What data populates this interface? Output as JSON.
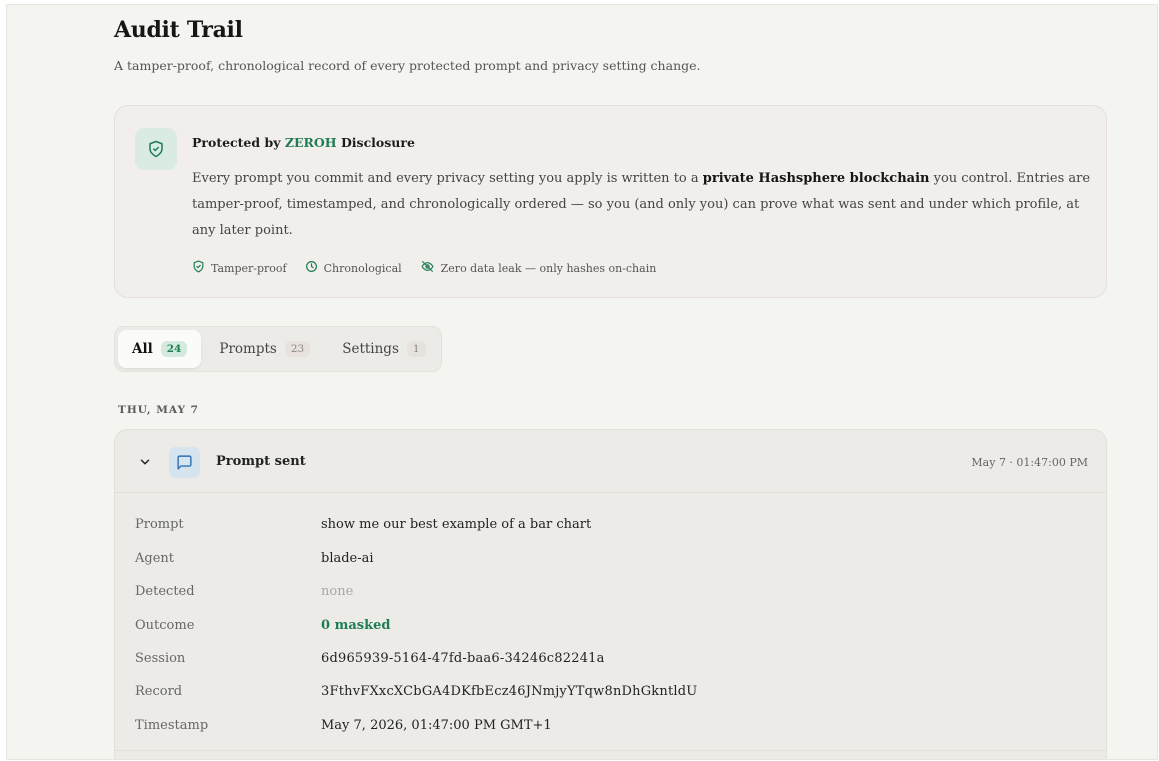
{
  "header": {
    "title": "Audit Trail",
    "subtitle": "A tamper-proof, chronological record of every protected prompt and privacy setting change."
  },
  "banner": {
    "icon": "shield-check-icon",
    "heading_prefix": "Protected by ",
    "heading_brand": "ZEROH",
    "heading_suffix": " Disclosure",
    "body_part1": "Every prompt you commit and every privacy setting you apply is written to a ",
    "body_bold": "private Hashsphere blockchain",
    "body_part2": " you control. Entries are tamper-proof, timestamped, and chronologically ordered — so you (and only you) can prove what was sent and under which profile, at any later point.",
    "features": [
      {
        "icon": "shield-check-icon",
        "label": "Tamper-proof"
      },
      {
        "icon": "clock-icon",
        "label": "Chronological"
      },
      {
        "icon": "eye-off-icon",
        "label": "Zero data leak — only hashes on-chain"
      }
    ]
  },
  "tabs": [
    {
      "label": "All",
      "count": "24",
      "active": true
    },
    {
      "label": "Prompts",
      "count": "23",
      "active": false
    },
    {
      "label": "Settings",
      "count": "1",
      "active": false
    }
  ],
  "groups": [
    {
      "date": "THU, MAY 7",
      "entries": [
        {
          "icon": "message-square-icon",
          "title": "Prompt sent",
          "time": "May 7 · 01:47:00 PM",
          "expanded": true,
          "details": [
            {
              "label": "Prompt",
              "value": "show me our best example of a bar chart"
            },
            {
              "label": "Agent",
              "value": "blade-ai"
            },
            {
              "label": "Detected",
              "value": "none"
            },
            {
              "label": "Outcome",
              "value": "0 masked"
            },
            {
              "label": "Session",
              "value": "6d965939-5164-47fd-baa6-34246c82241a"
            },
            {
              "label": "Record",
              "value": "3FthvFXxcXCbGA4DKfbEcz46JNmjyYTqw8nDhGkntldU"
            },
            {
              "label": "Timestamp",
              "value": "May 7, 2026, 01:47:00 PM GMT+1"
            }
          ]
        }
      ]
    }
  ],
  "colors": {
    "accent_green": "#1f7d56",
    "background": "#f4f4f0",
    "banner_bg": "#f1eeec",
    "card_bg": "#ecebe7",
    "icon_blue_bg": "#d6e4f0"
  }
}
